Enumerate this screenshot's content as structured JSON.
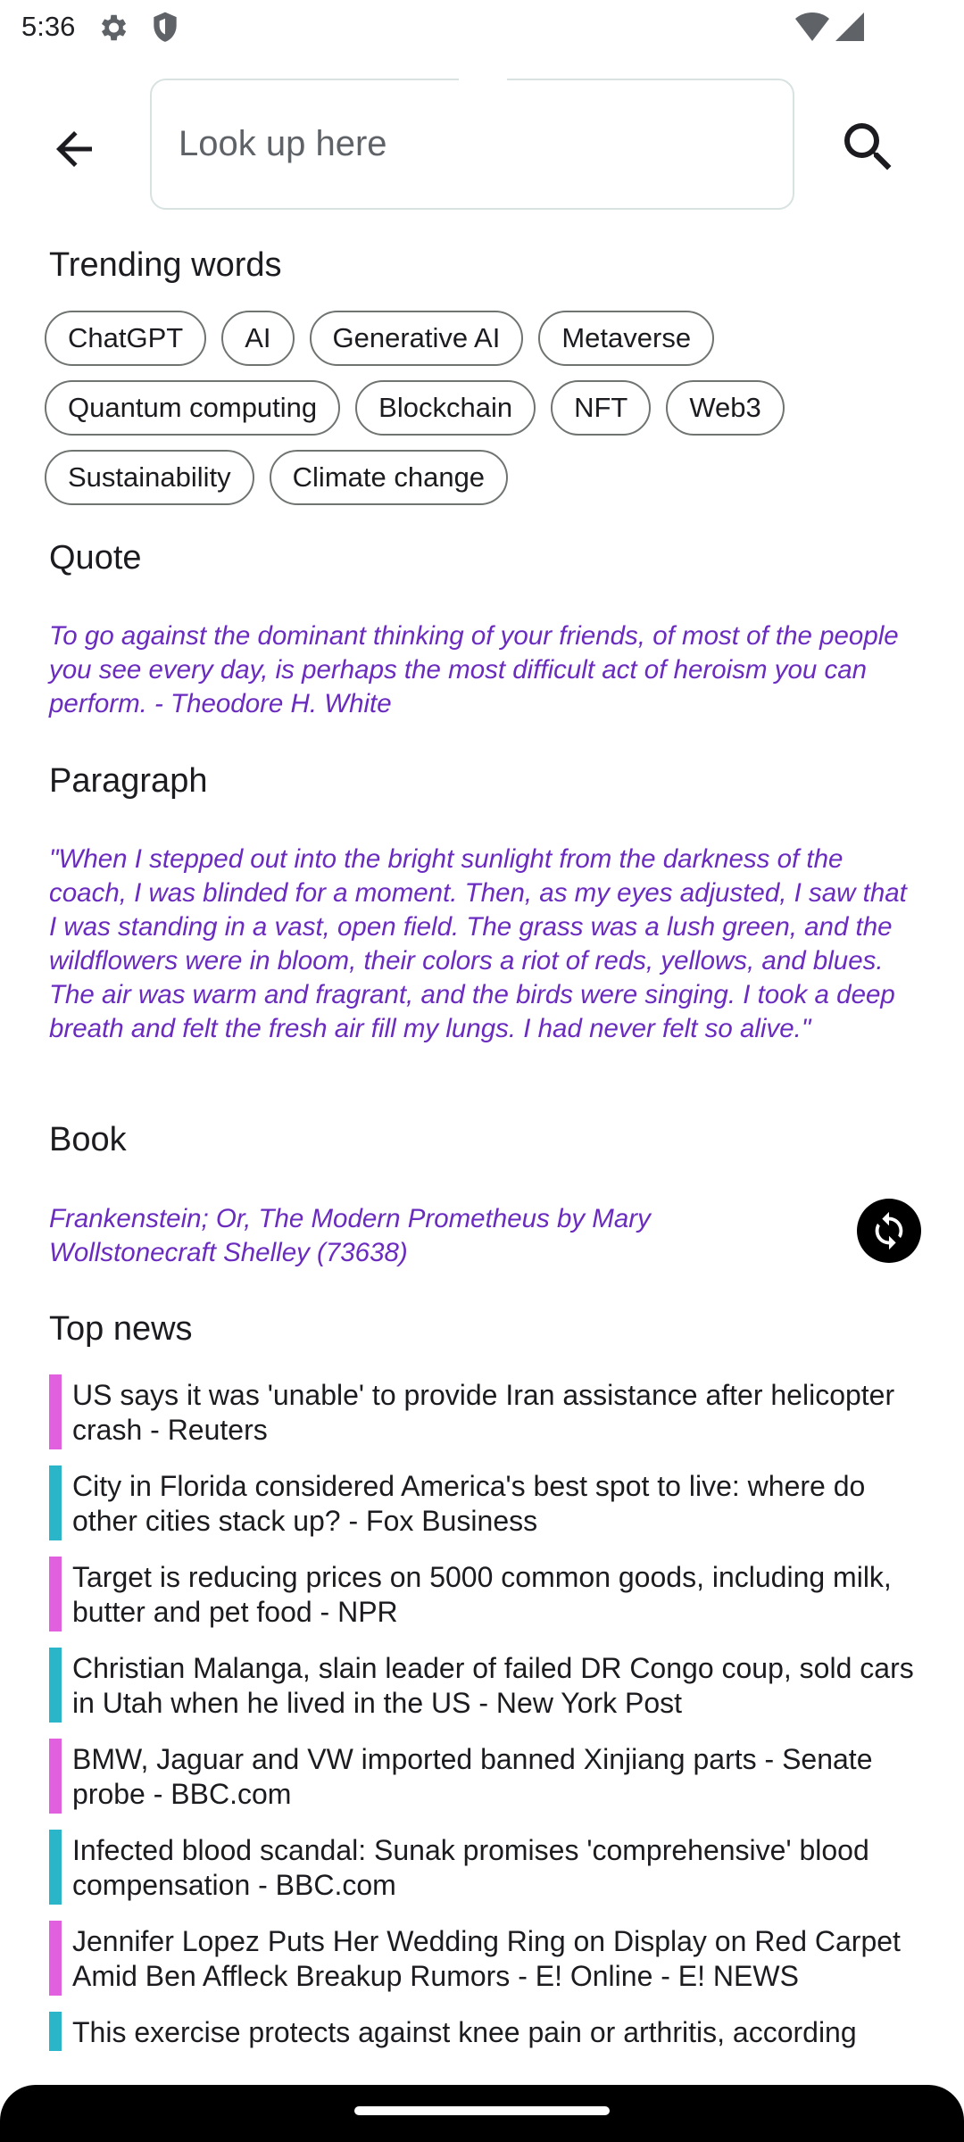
{
  "status_bar": {
    "time": "5:36"
  },
  "search": {
    "placeholder": "Look up here"
  },
  "trending": {
    "title": "Trending words",
    "chips": [
      "ChatGPT",
      "AI",
      "Generative AI",
      "Metaverse",
      "Quantum computing",
      "Blockchain",
      "NFT",
      "Web3",
      "Sustainability",
      "Climate change"
    ]
  },
  "quote": {
    "title": "Quote",
    "text": "To go against the dominant thinking of your friends, of most of the people you see every day, is perhaps the most difficult act of heroism you can perform. - Theodore H. White"
  },
  "paragraph": {
    "title": "Paragraph",
    "text": "\"When I stepped out into the bright sunlight from the darkness of the coach, I was blinded for a moment. Then, as my eyes adjusted, I saw that I was standing in a vast, open field. The grass was a lush green, and the wildflowers were in bloom, their colors a riot of reds, yellows, and blues. The air was warm and fragrant, and the birds were singing. I took a deep breath and felt the fresh air fill my lungs. I had never felt so alive.\""
  },
  "book": {
    "title": "Book",
    "text": "Frankenstein; Or, The Modern Prometheus by Mary Wollstonecraft Shelley (73638)"
  },
  "news": {
    "title": "Top news",
    "items": [
      "US says it was 'unable' to provide Iran assistance after helicopter crash - Reuters",
      "City in Florida considered America's best spot to live: where do other cities stack up? - Fox Business",
      "Target is reducing prices on 5000 common goods, including milk, butter and pet food - NPR",
      "Christian Malanga, slain leader of failed DR Congo coup, sold cars in Utah when he lived in the US - New York Post",
      "BMW, Jaguar and VW imported banned Xinjiang parts - Senate probe - BBC.com",
      "Infected blood scandal: Sunak promises 'comprehensive' blood compensation - BBC.com",
      "Jennifer Lopez Puts Her Wedding Ring on Display on Red Carpet Amid Ben Affleck Breakup Rumors - E! Online - E! NEWS",
      "This exercise protects against knee pain or arthritis, according"
    ]
  },
  "colors": {
    "quote_text": "#6a2bbf",
    "news_bar_a": "#e060e0",
    "news_bar_b": "#2bb5c8"
  },
  "icons": [
    "gear-icon",
    "shield-icon",
    "wifi-icon",
    "signal-icon",
    "back-arrow-icon",
    "search-icon",
    "refresh-icon"
  ]
}
